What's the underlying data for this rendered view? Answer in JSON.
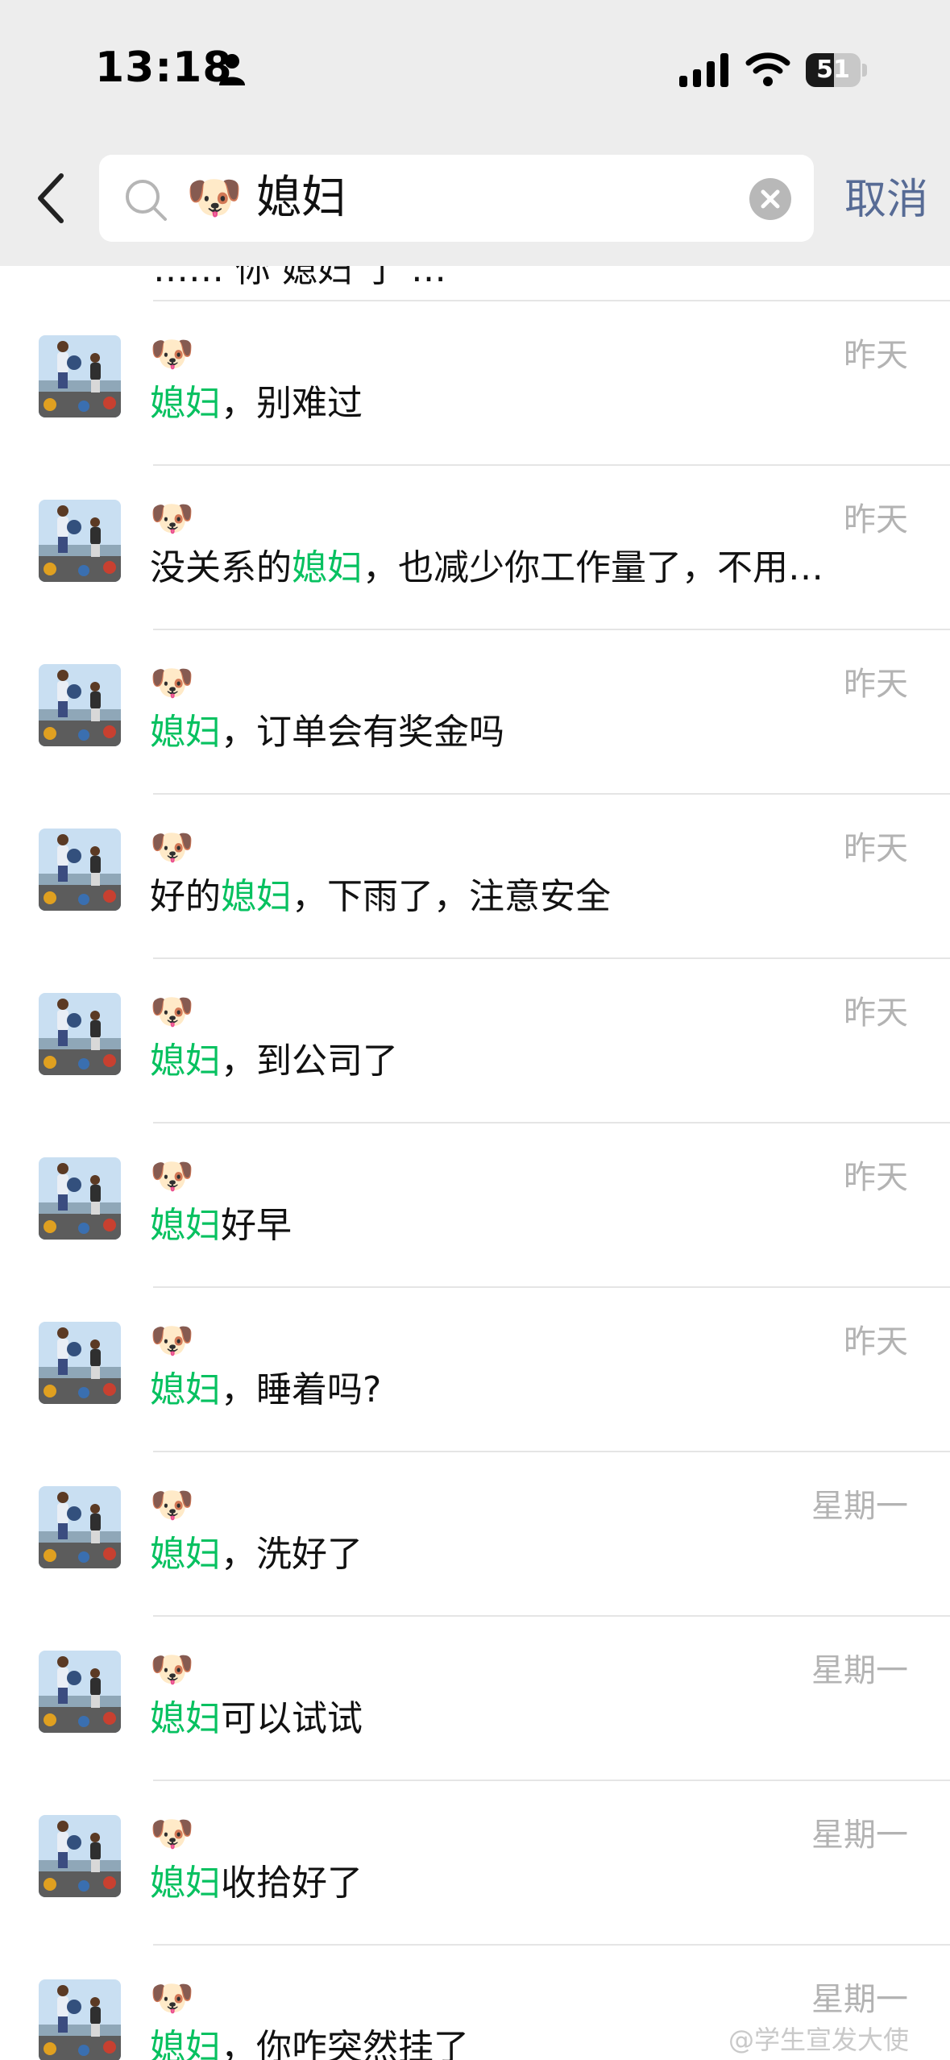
{
  "status_bar": {
    "time": "13:18",
    "battery": "51",
    "battery_level": 0.51
  },
  "search": {
    "query_emoji": "🐶",
    "query_text": "媳妇",
    "cancel_label": "取消"
  },
  "partial_result": {
    "text": "…… 你 媳妇 了 …"
  },
  "results": [
    {
      "sender": "🐶",
      "before": "",
      "highlight": "媳妇",
      "after": "，别难过",
      "date": "昨天"
    },
    {
      "sender": "🐶",
      "before": "没关系的",
      "highlight": "媳妇",
      "after": "，也减少你工作量了，不用…",
      "date": "昨天"
    },
    {
      "sender": "🐶",
      "before": "",
      "highlight": "媳妇",
      "after": "，订单会有奖金吗",
      "date": "昨天"
    },
    {
      "sender": "🐶",
      "before": "好的",
      "highlight": "媳妇",
      "after": "，下雨了，注意安全",
      "date": "昨天"
    },
    {
      "sender": "🐶",
      "before": "",
      "highlight": "媳妇",
      "after": "，到公司了",
      "date": "昨天"
    },
    {
      "sender": "🐶",
      "before": "",
      "highlight": "媳妇",
      "after": "好早",
      "date": "昨天"
    },
    {
      "sender": "🐶",
      "before": "",
      "highlight": "媳妇",
      "after": "，睡着吗?",
      "date": "昨天"
    },
    {
      "sender": "🐶",
      "before": "",
      "highlight": "媳妇",
      "after": "，洗好了",
      "date": "星期一"
    },
    {
      "sender": "🐶",
      "before": "",
      "highlight": "媳妇",
      "after": "可以试试",
      "date": "星期一"
    },
    {
      "sender": "🐶",
      "before": "",
      "highlight": "媳妇",
      "after": "收拾好了",
      "date": "星期一"
    },
    {
      "sender": "🐶",
      "before": "",
      "highlight": "媳妇",
      "after": "，你咋突然挂了",
      "date": "星期一"
    }
  ],
  "watermark": "@学生宣发大使",
  "colors": {
    "highlight": "#07c160",
    "link": "#576b95",
    "date": "#b3b3b3",
    "header_bg": "#ededed"
  }
}
